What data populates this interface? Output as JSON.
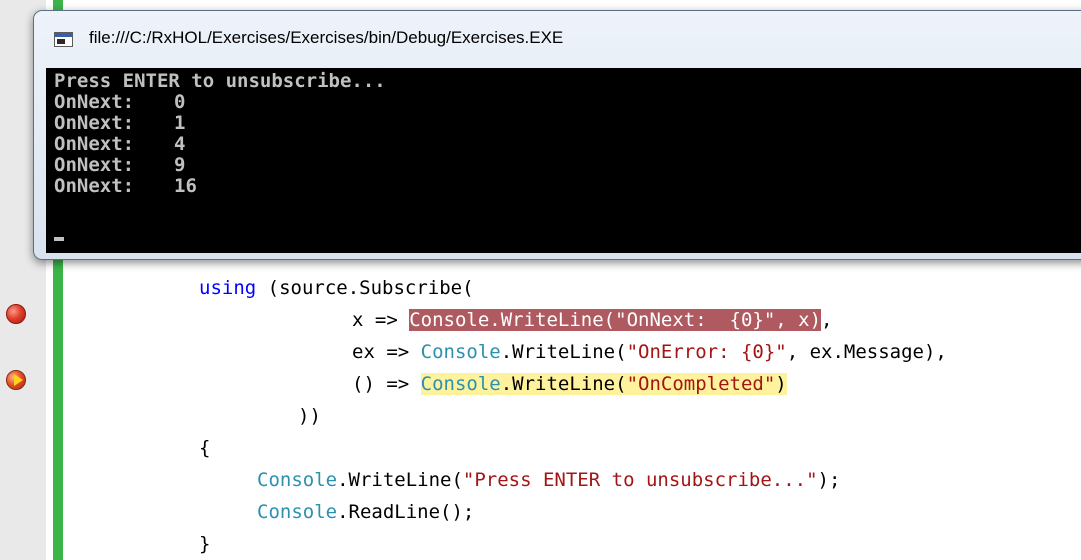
{
  "console": {
    "title": "file:///C:/RxHOL/Exercises/Exercises/bin/Debug/Exercises.EXE",
    "prompt": "Press ENTER to unsubscribe...",
    "label": "OnNext:",
    "values": [
      "0",
      "1",
      "4",
      "9",
      "16"
    ],
    "colors": {
      "background": "#000000",
      "text": "#c0c0c0"
    }
  },
  "editor": {
    "colors": {
      "keyword": "#0000ff",
      "type": "#2b91af",
      "string": "#a31515",
      "breakpoint_highlight": "#ae5a60",
      "current_highlight": "#fff29d",
      "change_bar": "#3bb54a"
    },
    "lines": [
      {
        "kw": "using",
        "rest": " (source.Subscribe("
      },
      {
        "pre": "x => ",
        "type": "Console",
        "call": ".WriteLine(",
        "str": "\"OnNext:  {0}\"",
        "post": ", x)",
        "tail": ","
      },
      {
        "pre": "ex => ",
        "type": "Console",
        "call": ".WriteLine(",
        "str": "\"OnError: {0}\"",
        "post": ", ex.Message),"
      },
      {
        "pre": "() => ",
        "type": "Console",
        "call": ".WriteLine(",
        "str": "\"OnCompleted\"",
        "post": ")"
      },
      {
        "text": "))"
      },
      {
        "text": "{"
      },
      {
        "type": "Console",
        "call": ".WriteLine(",
        "str": "\"Press ENTER to unsubscribe...\"",
        "post": ");"
      },
      {
        "type": "Console",
        "call": ".ReadLine();"
      },
      {
        "text": "}"
      }
    ]
  },
  "icons": {
    "console_icon": "console-window-icon",
    "breakpoint": "breakpoint-icon",
    "current_statement_breakpoint": "breakpoint-current-statement-icon"
  }
}
